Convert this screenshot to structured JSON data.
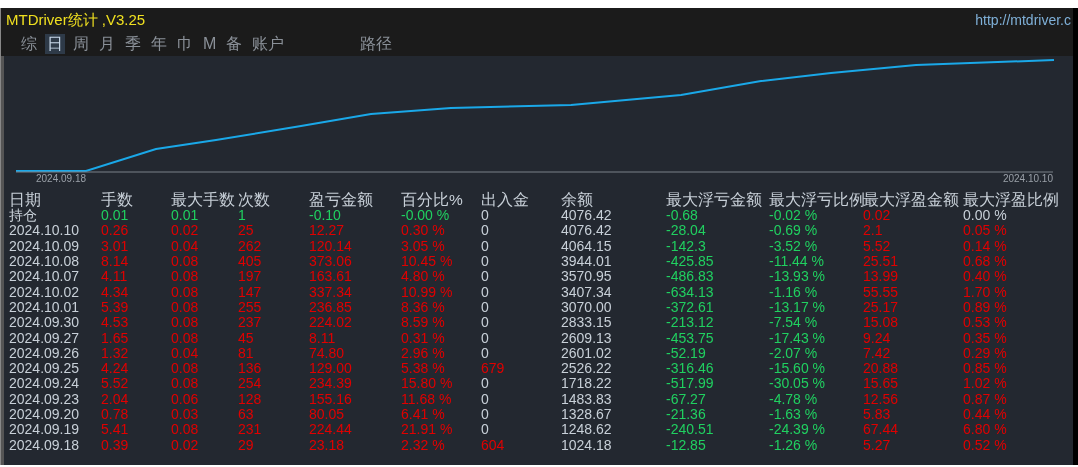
{
  "window": {
    "title": "MTDriver统计 ,V3.25",
    "url": "http://mtdriver.c"
  },
  "tabs": [
    {
      "label": "综",
      "selected": false
    },
    {
      "label": "日",
      "selected": true
    },
    {
      "label": "周",
      "selected": false
    },
    {
      "label": "月",
      "selected": false
    },
    {
      "label": "季",
      "selected": false
    },
    {
      "label": "年",
      "selected": false
    },
    {
      "label": "巾",
      "selected": false
    },
    {
      "label": "M",
      "selected": false
    },
    {
      "label": "备",
      "selected": false
    },
    {
      "label": "账户",
      "selected": false
    }
  ],
  "path_tab": {
    "label": "路径"
  },
  "chart": {
    "start_label": "2024.09.18",
    "end_label": "2024.10.10"
  },
  "table": {
    "columns": [
      "日期",
      "手数",
      "最大手数",
      "次数",
      "盈亏金额",
      "百分比%",
      "出入金",
      "余额",
      "最大浮亏金额",
      "最大浮亏比例",
      "最大浮盈金额",
      "最大浮盈比例"
    ],
    "rows": [
      {
        "cells": [
          {
            "text": "持仓",
            "color": "#c8d0d8"
          },
          {
            "text": "0.01",
            "color": "#20d060"
          },
          {
            "text": "0.01",
            "color": "#20d060"
          },
          {
            "text": "1",
            "color": "#20d060"
          },
          {
            "text": "-0.10",
            "color": "#20d060"
          },
          {
            "text": "-0.00 %",
            "color": "#20d060"
          },
          {
            "text": "0",
            "color": "#c8d0d8"
          },
          {
            "text": "4076.42",
            "color": "#c8d0d8"
          },
          {
            "text": "-0.68",
            "color": "#20d060"
          },
          {
            "text": "-0.02 %",
            "color": "#20d060"
          },
          {
            "text": "0.02",
            "color": "#e00000"
          },
          {
            "text": "0.00 %",
            "color": "#c8d0d8"
          }
        ]
      },
      {
        "cells": [
          {
            "text": "2024.10.10",
            "color": "#c8d0d8"
          },
          {
            "text": "0.26",
            "color": "#e00000"
          },
          {
            "text": "0.02",
            "color": "#e00000"
          },
          {
            "text": "25",
            "color": "#e00000"
          },
          {
            "text": "12.27",
            "color": "#e00000"
          },
          {
            "text": "0.30 %",
            "color": "#e00000"
          },
          {
            "text": "0",
            "color": "#c8d0d8"
          },
          {
            "text": "4076.42",
            "color": "#c8d0d8"
          },
          {
            "text": "-28.04",
            "color": "#20d060"
          },
          {
            "text": "-0.69 %",
            "color": "#20d060"
          },
          {
            "text": "2.1",
            "color": "#e00000"
          },
          {
            "text": "0.05 %",
            "color": "#e00000"
          }
        ]
      },
      {
        "cells": [
          {
            "text": "2024.10.09",
            "color": "#c8d0d8"
          },
          {
            "text": "3.01",
            "color": "#e00000"
          },
          {
            "text": "0.04",
            "color": "#e00000"
          },
          {
            "text": "262",
            "color": "#e00000"
          },
          {
            "text": "120.14",
            "color": "#e00000"
          },
          {
            "text": "3.05 %",
            "color": "#e00000"
          },
          {
            "text": "0",
            "color": "#c8d0d8"
          },
          {
            "text": "4064.15",
            "color": "#c8d0d8"
          },
          {
            "text": "-142.3",
            "color": "#20d060"
          },
          {
            "text": "-3.52 %",
            "color": "#20d060"
          },
          {
            "text": "5.52",
            "color": "#e00000"
          },
          {
            "text": "0.14 %",
            "color": "#e00000"
          }
        ]
      },
      {
        "cells": [
          {
            "text": "2024.10.08",
            "color": "#c8d0d8"
          },
          {
            "text": "8.14",
            "color": "#e00000"
          },
          {
            "text": "0.08",
            "color": "#e00000"
          },
          {
            "text": "405",
            "color": "#e00000"
          },
          {
            "text": "373.06",
            "color": "#e00000"
          },
          {
            "text": "10.45 %",
            "color": "#e00000"
          },
          {
            "text": "0",
            "color": "#c8d0d8"
          },
          {
            "text": "3944.01",
            "color": "#c8d0d8"
          },
          {
            "text": "-425.85",
            "color": "#20d060"
          },
          {
            "text": "-11.44 %",
            "color": "#20d060"
          },
          {
            "text": "25.51",
            "color": "#e00000"
          },
          {
            "text": "0.68 %",
            "color": "#e00000"
          }
        ]
      },
      {
        "cells": [
          {
            "text": "2024.10.07",
            "color": "#c8d0d8"
          },
          {
            "text": "4.11",
            "color": "#e00000"
          },
          {
            "text": "0.08",
            "color": "#e00000"
          },
          {
            "text": "197",
            "color": "#e00000"
          },
          {
            "text": "163.61",
            "color": "#e00000"
          },
          {
            "text": "4.80 %",
            "color": "#e00000"
          },
          {
            "text": "0",
            "color": "#c8d0d8"
          },
          {
            "text": "3570.95",
            "color": "#c8d0d8"
          },
          {
            "text": "-486.83",
            "color": "#20d060"
          },
          {
            "text": "-13.93 %",
            "color": "#20d060"
          },
          {
            "text": "13.99",
            "color": "#e00000"
          },
          {
            "text": "0.40 %",
            "color": "#e00000"
          }
        ]
      },
      {
        "cells": [
          {
            "text": "2024.10.02",
            "color": "#c8d0d8"
          },
          {
            "text": "4.34",
            "color": "#e00000"
          },
          {
            "text": "0.08",
            "color": "#e00000"
          },
          {
            "text": "147",
            "color": "#e00000"
          },
          {
            "text": "337.34",
            "color": "#e00000"
          },
          {
            "text": "10.99 %",
            "color": "#e00000"
          },
          {
            "text": "0",
            "color": "#c8d0d8"
          },
          {
            "text": "3407.34",
            "color": "#c8d0d8"
          },
          {
            "text": "-634.13",
            "color": "#20d060"
          },
          {
            "text": "-1.16 %",
            "color": "#20d060"
          },
          {
            "text": "55.55",
            "color": "#e00000"
          },
          {
            "text": "1.70 %",
            "color": "#e00000"
          }
        ]
      },
      {
        "cells": [
          {
            "text": "2024.10.01",
            "color": "#c8d0d8"
          },
          {
            "text": "5.39",
            "color": "#e00000"
          },
          {
            "text": "0.08",
            "color": "#e00000"
          },
          {
            "text": "255",
            "color": "#e00000"
          },
          {
            "text": "236.85",
            "color": "#e00000"
          },
          {
            "text": "8.36 %",
            "color": "#e00000"
          },
          {
            "text": "0",
            "color": "#c8d0d8"
          },
          {
            "text": "3070.00",
            "color": "#c8d0d8"
          },
          {
            "text": "-372.61",
            "color": "#20d060"
          },
          {
            "text": "-13.17 %",
            "color": "#20d060"
          },
          {
            "text": "25.17",
            "color": "#e00000"
          },
          {
            "text": "0.89 %",
            "color": "#e00000"
          }
        ]
      },
      {
        "cells": [
          {
            "text": "2024.09.30",
            "color": "#c8d0d8"
          },
          {
            "text": "4.53",
            "color": "#e00000"
          },
          {
            "text": "0.08",
            "color": "#e00000"
          },
          {
            "text": "237",
            "color": "#e00000"
          },
          {
            "text": "224.02",
            "color": "#e00000"
          },
          {
            "text": "8.59 %",
            "color": "#e00000"
          },
          {
            "text": "0",
            "color": "#c8d0d8"
          },
          {
            "text": "2833.15",
            "color": "#c8d0d8"
          },
          {
            "text": "-213.12",
            "color": "#20d060"
          },
          {
            "text": "-7.54 %",
            "color": "#20d060"
          },
          {
            "text": "15.08",
            "color": "#e00000"
          },
          {
            "text": "0.53 %",
            "color": "#e00000"
          }
        ]
      },
      {
        "cells": [
          {
            "text": "2024.09.27",
            "color": "#c8d0d8"
          },
          {
            "text": "1.65",
            "color": "#e00000"
          },
          {
            "text": "0.08",
            "color": "#e00000"
          },
          {
            "text": "45",
            "color": "#e00000"
          },
          {
            "text": "8.11",
            "color": "#e00000"
          },
          {
            "text": "0.31 %",
            "color": "#e00000"
          },
          {
            "text": "0",
            "color": "#c8d0d8"
          },
          {
            "text": "2609.13",
            "color": "#c8d0d8"
          },
          {
            "text": "-453.75",
            "color": "#20d060"
          },
          {
            "text": "-17.43 %",
            "color": "#20d060"
          },
          {
            "text": "9.24",
            "color": "#e00000"
          },
          {
            "text": "0.35 %",
            "color": "#e00000"
          }
        ]
      },
      {
        "cells": [
          {
            "text": "2024.09.26",
            "color": "#c8d0d8"
          },
          {
            "text": "1.32",
            "color": "#e00000"
          },
          {
            "text": "0.04",
            "color": "#e00000"
          },
          {
            "text": "81",
            "color": "#e00000"
          },
          {
            "text": "74.80",
            "color": "#e00000"
          },
          {
            "text": "2.96 %",
            "color": "#e00000"
          },
          {
            "text": "0",
            "color": "#c8d0d8"
          },
          {
            "text": "2601.02",
            "color": "#c8d0d8"
          },
          {
            "text": "-52.19",
            "color": "#20d060"
          },
          {
            "text": "-2.07 %",
            "color": "#20d060"
          },
          {
            "text": "7.42",
            "color": "#e00000"
          },
          {
            "text": "0.29 %",
            "color": "#e00000"
          }
        ]
      },
      {
        "cells": [
          {
            "text": "2024.09.25",
            "color": "#c8d0d8"
          },
          {
            "text": "4.24",
            "color": "#e00000"
          },
          {
            "text": "0.08",
            "color": "#e00000"
          },
          {
            "text": "136",
            "color": "#e00000"
          },
          {
            "text": "129.00",
            "color": "#e00000"
          },
          {
            "text": "5.38 %",
            "color": "#e00000"
          },
          {
            "text": "679",
            "color": "#e00000"
          },
          {
            "text": "2526.22",
            "color": "#c8d0d8"
          },
          {
            "text": "-316.46",
            "color": "#20d060"
          },
          {
            "text": "-15.60 %",
            "color": "#20d060"
          },
          {
            "text": "20.88",
            "color": "#e00000"
          },
          {
            "text": "0.85 %",
            "color": "#e00000"
          }
        ]
      },
      {
        "cells": [
          {
            "text": "2024.09.24",
            "color": "#c8d0d8"
          },
          {
            "text": "5.52",
            "color": "#e00000"
          },
          {
            "text": "0.08",
            "color": "#e00000"
          },
          {
            "text": "254",
            "color": "#e00000"
          },
          {
            "text": "234.39",
            "color": "#e00000"
          },
          {
            "text": "15.80 %",
            "color": "#e00000"
          },
          {
            "text": "0",
            "color": "#c8d0d8"
          },
          {
            "text": "1718.22",
            "color": "#c8d0d8"
          },
          {
            "text": "-517.99",
            "color": "#20d060"
          },
          {
            "text": "-30.05 %",
            "color": "#20d060"
          },
          {
            "text": "15.65",
            "color": "#e00000"
          },
          {
            "text": "1.02 %",
            "color": "#e00000"
          }
        ]
      },
      {
        "cells": [
          {
            "text": "2024.09.23",
            "color": "#c8d0d8"
          },
          {
            "text": "2.04",
            "color": "#e00000"
          },
          {
            "text": "0.06",
            "color": "#e00000"
          },
          {
            "text": "128",
            "color": "#e00000"
          },
          {
            "text": "155.16",
            "color": "#e00000"
          },
          {
            "text": "11.68 %",
            "color": "#e00000"
          },
          {
            "text": "0",
            "color": "#c8d0d8"
          },
          {
            "text": "1483.83",
            "color": "#c8d0d8"
          },
          {
            "text": "-67.27",
            "color": "#20d060"
          },
          {
            "text": "-4.78 %",
            "color": "#20d060"
          },
          {
            "text": "12.56",
            "color": "#e00000"
          },
          {
            "text": "0.87 %",
            "color": "#e00000"
          }
        ]
      },
      {
        "cells": [
          {
            "text": "2024.09.20",
            "color": "#c8d0d8"
          },
          {
            "text": "0.78",
            "color": "#e00000"
          },
          {
            "text": "0.03",
            "color": "#e00000"
          },
          {
            "text": "63",
            "color": "#e00000"
          },
          {
            "text": "80.05",
            "color": "#e00000"
          },
          {
            "text": "6.41 %",
            "color": "#e00000"
          },
          {
            "text": "0",
            "color": "#c8d0d8"
          },
          {
            "text": "1328.67",
            "color": "#c8d0d8"
          },
          {
            "text": "-21.36",
            "color": "#20d060"
          },
          {
            "text": "-1.63 %",
            "color": "#20d060"
          },
          {
            "text": "5.83",
            "color": "#e00000"
          },
          {
            "text": "0.44 %",
            "color": "#e00000"
          }
        ]
      },
      {
        "cells": [
          {
            "text": "2024.09.19",
            "color": "#c8d0d8"
          },
          {
            "text": "5.41",
            "color": "#e00000"
          },
          {
            "text": "0.08",
            "color": "#e00000"
          },
          {
            "text": "231",
            "color": "#e00000"
          },
          {
            "text": "224.44",
            "color": "#e00000"
          },
          {
            "text": "21.91 %",
            "color": "#e00000"
          },
          {
            "text": "0",
            "color": "#c8d0d8"
          },
          {
            "text": "1248.62",
            "color": "#c8d0d8"
          },
          {
            "text": "-240.51",
            "color": "#20d060"
          },
          {
            "text": "-24.39 %",
            "color": "#20d060"
          },
          {
            "text": "67.44",
            "color": "#e00000"
          },
          {
            "text": "6.80 %",
            "color": "#e00000"
          }
        ]
      },
      {
        "cells": [
          {
            "text": "2024.09.18",
            "color": "#c8d0d8"
          },
          {
            "text": "0.39",
            "color": "#e00000"
          },
          {
            "text": "0.02",
            "color": "#e00000"
          },
          {
            "text": "29",
            "color": "#e00000"
          },
          {
            "text": "23.18",
            "color": "#e00000"
          },
          {
            "text": "2.32 %",
            "color": "#e00000"
          },
          {
            "text": "604",
            "color": "#e00000"
          },
          {
            "text": "1024.18",
            "color": "#c8d0d8"
          },
          {
            "text": "-12.85",
            "color": "#20d060"
          },
          {
            "text": "-1.26 %",
            "color": "#20d060"
          },
          {
            "text": "5.27",
            "color": "#e00000"
          },
          {
            "text": "0.52 %",
            "color": "#e00000"
          }
        ]
      }
    ]
  }
}
